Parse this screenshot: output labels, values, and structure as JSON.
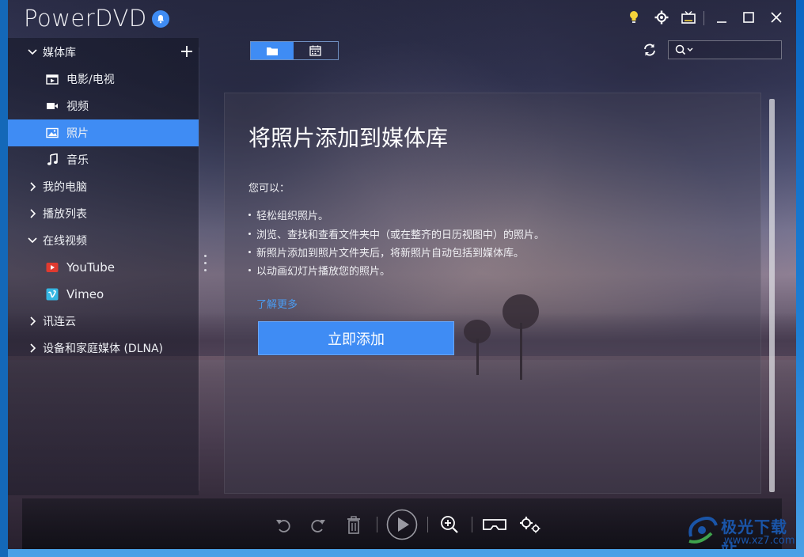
{
  "window": {
    "app_title": "PowerDVD"
  },
  "toolbar": {
    "icons": [
      "lightbulb-icon",
      "gear-icon",
      "tv-icon",
      "minimize-icon",
      "maximize-icon",
      "close-icon"
    ]
  },
  "sidebar": {
    "items": [
      {
        "label": "媒体库",
        "icon": "chevron-down-icon"
      },
      {
        "label": "电影/电视",
        "icon": "movie-icon"
      },
      {
        "label": "视频",
        "icon": "video-camera-icon"
      },
      {
        "label": "照片",
        "icon": "photo-icon"
      },
      {
        "label": "音乐",
        "icon": "music-note-icon"
      },
      {
        "label": "我的电脑",
        "icon": "chevron-right-icon"
      },
      {
        "label": "播放列表",
        "icon": "chevron-right-icon"
      },
      {
        "label": "在线视频",
        "icon": "chevron-down-icon"
      },
      {
        "label": "YouTube",
        "icon": "youtube-icon"
      },
      {
        "label": "Vimeo",
        "icon": "vimeo-icon"
      },
      {
        "label": "讯连云",
        "icon": "chevron-right-icon"
      },
      {
        "label": "设备和家庭媒体 (DLNA)",
        "icon": "chevron-right-icon"
      }
    ],
    "selected": "照片"
  },
  "content": {
    "title": "将照片添加到媒体库",
    "subtitle": "您可以：",
    "bullets": [
      "轻松组织照片。",
      "浏览、查找和查看文件夹中（或在整齐的日历视图中）的照片。",
      "新照片添加到照片文件夹后，将新照片自动包括到媒体库。",
      "以动画幻灯片播放您的照片。"
    ],
    "learn_more": "了解更多",
    "add_button": "立即添加"
  },
  "watermark": {
    "text": "极光下载站",
    "url": "www.xz7.com"
  },
  "colors": {
    "accent": "#3f8cf4",
    "link": "#4a9cf2"
  }
}
